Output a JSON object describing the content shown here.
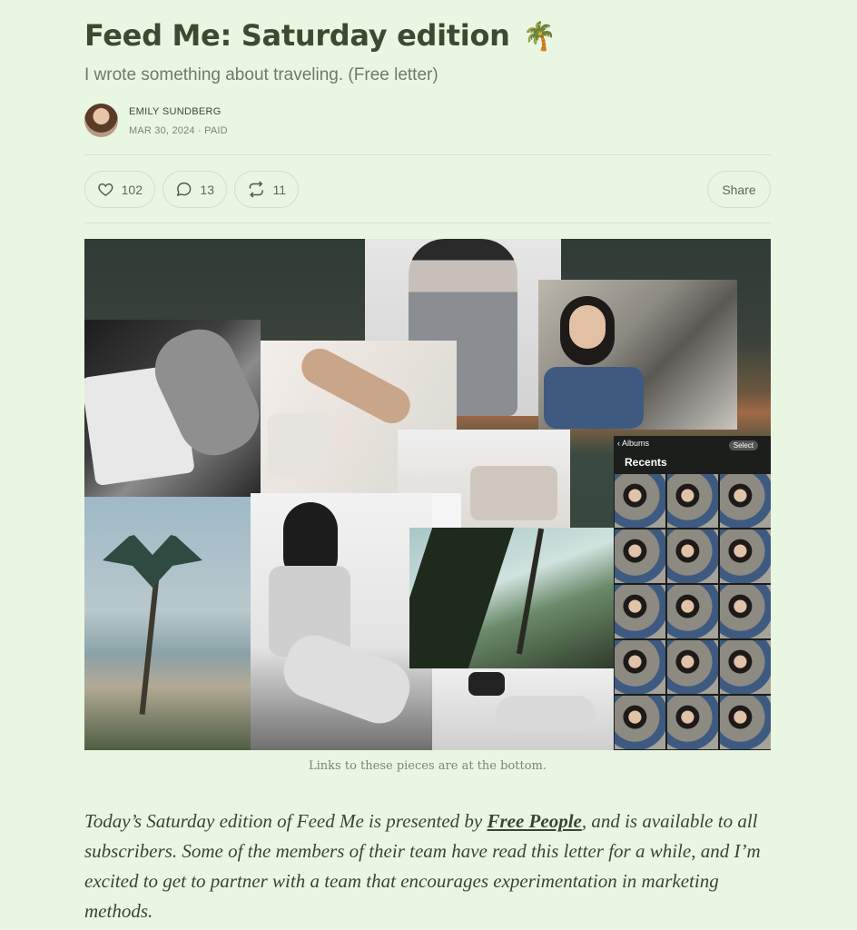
{
  "post": {
    "title": "Feed Me: Saturday edition",
    "title_emoji": "🌴",
    "subtitle": "I wrote something about traveling. (Free letter)",
    "author": "EMILY SUNDBERG",
    "meta": "MAR 30, 2024 · PAID"
  },
  "actions": {
    "likes": "102",
    "comments": "13",
    "restacks": "11",
    "share_label": "Share"
  },
  "hero": {
    "caption": "Links to these pieces are at the bottom.",
    "albums_back": "Albums",
    "albums_select": "Select",
    "albums_title": "Recents"
  },
  "body": {
    "text_before": "Today’s Saturday edition of Feed Me is presented by ",
    "link": "Free People",
    "text_after": ", and is available to all subscribers. Some of the members of their team have read this letter for a while, and I’m excited to get to partner with a team that encourages experimentation in marketing methods."
  },
  "colors": {
    "background": "#e9f7e2",
    "title": "#3d4a32",
    "border": "#d2e0ca"
  }
}
